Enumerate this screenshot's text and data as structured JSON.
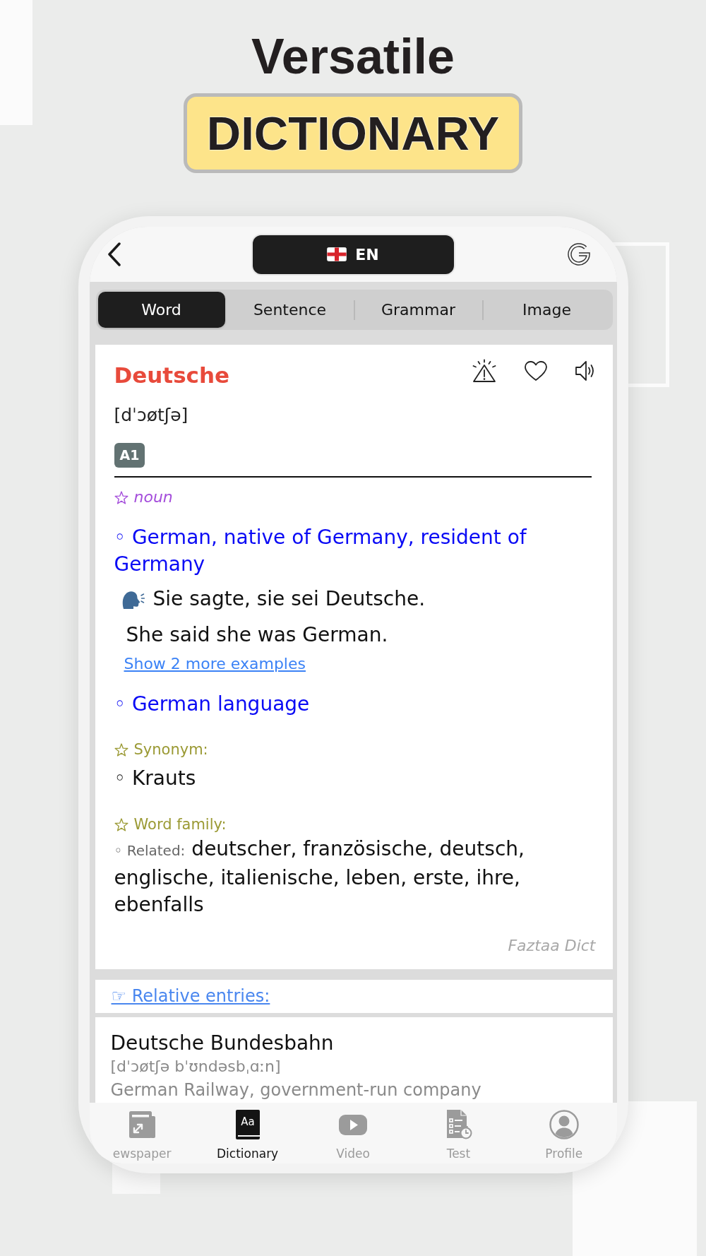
{
  "headline": {
    "title": "Versatile",
    "badge": "DICTIONARY"
  },
  "top_bar": {
    "language": "EN"
  },
  "tabs": [
    {
      "label": "Word",
      "selected": true
    },
    {
      "label": "Sentence",
      "selected": false
    },
    {
      "label": "Grammar",
      "selected": false
    },
    {
      "label": "Image",
      "selected": false
    }
  ],
  "entry": {
    "word": "Deutsche",
    "phonetic": "[dˈɔøtʃə]",
    "cefr_badge": "A1",
    "part_of_speech": "noun",
    "senses": [
      {
        "definition": "◦ German, native of Germany, resident of Germany",
        "examples": [
          {
            "sentence": "Sie sagte, sie sei Deutsche.",
            "translation": "She said she was German."
          }
        ],
        "more_examples_link": "Show 2 more examples"
      },
      {
        "definition": "◦ German language"
      }
    ],
    "synonym_heading": "Synonym:",
    "synonyms": [
      "◦ Krauts"
    ],
    "word_family_heading": "Word family:",
    "related_label": "◦ Related:",
    "related_words": "deutscher, französische, deutsch, englische, italienische, leben, erste, ihre, ebenfalls",
    "source": "Faztaa Dict"
  },
  "relative_entries": {
    "heading": "☞ Relative entries:",
    "items": [
      {
        "word": "Deutsche Bundesbahn",
        "phonetic": "[dˈɔøtʃə bˈʊndəsbˌɑːn]",
        "meaning": "German Railway, government-run company"
      }
    ]
  },
  "bottom_nav": [
    {
      "kind": "newspaper",
      "label": "ewspaper",
      "selected": false
    },
    {
      "kind": "dictionary",
      "label": "Dictionary",
      "icon_text": "Aa",
      "selected": true
    },
    {
      "kind": "video",
      "label": "Video",
      "selected": false
    },
    {
      "kind": "test",
      "label": "Test",
      "selected": false
    },
    {
      "kind": "profile",
      "label": "Profile",
      "selected": false
    }
  ]
}
